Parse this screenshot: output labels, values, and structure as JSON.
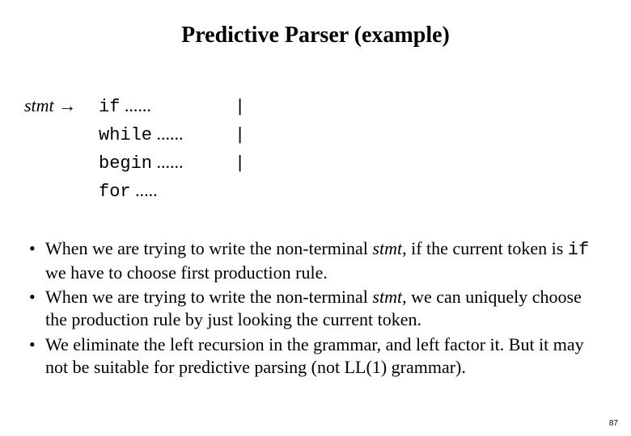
{
  "title": "Predictive Parser (example)",
  "grammar": {
    "lhs": "stmt",
    "arrow": " → ",
    "rules": [
      {
        "kw": "if",
        "dots": " ......",
        "pipe": "|"
      },
      {
        "kw": "while",
        "dots": " ......",
        "pipe": "|"
      },
      {
        "kw": "begin",
        "dots": " ......",
        "pipe": "|"
      },
      {
        "kw": "for",
        "dots": " .....",
        "pipe": ""
      }
    ]
  },
  "bullets": {
    "b1a": "When we are trying to write the non-terminal ",
    "b1_stmt": "stmt",
    "b1b": ", if the current token is ",
    "b1_code": "if",
    "b1c": " we have to choose first production rule.",
    "b2a": "When we are trying to write the non-terminal ",
    "b2_stmt": "stmt",
    "b2b": ", we can uniquely choose the production rule by just looking the current token.",
    "b3": "We eliminate the left recursion in the grammar, and left factor it. But it may not be suitable for predictive parsing (not LL(1) grammar)."
  },
  "pagenum": "87"
}
